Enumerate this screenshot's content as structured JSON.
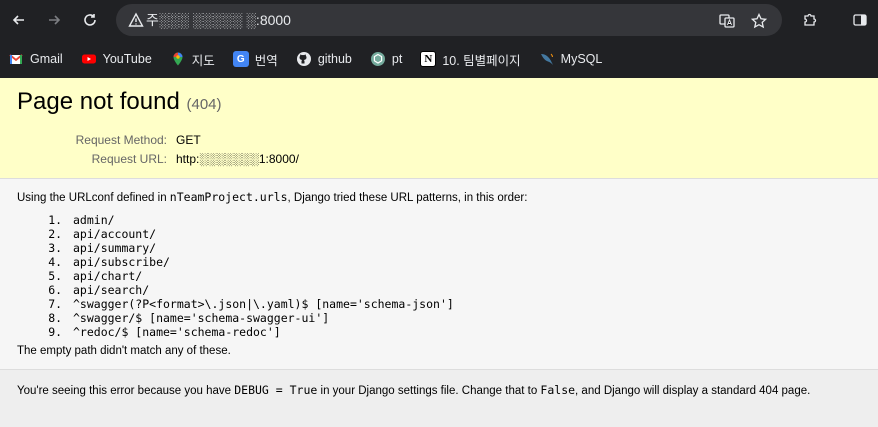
{
  "browser": {
    "url": "주░░░ ░░░░░ ░:8000",
    "bookmarks": [
      {
        "label": "Gmail",
        "icon": "gmail-icon"
      },
      {
        "label": "YouTube",
        "icon": "youtube-icon"
      },
      {
        "label": "지도",
        "icon": "maps-icon"
      },
      {
        "label": "번역",
        "icon": "translate-icon"
      },
      {
        "label": "github",
        "icon": "github-icon"
      },
      {
        "label": "pt",
        "icon": "chatgpt-icon"
      },
      {
        "label": "10. 팀별페이지",
        "icon": "notion-icon"
      },
      {
        "label": "MySQL",
        "icon": "mysql-icon"
      }
    ]
  },
  "summary": {
    "title": "Page not found",
    "code": "(404)",
    "request_method_label": "Request Method:",
    "request_method": "GET",
    "request_url_label": "Request URL:",
    "request_url": "http:░░░░░░░1:8000/"
  },
  "info": {
    "intro_prefix": "Using the URLconf defined in ",
    "urlconf": "nTeamProject.urls",
    "intro_suffix": ", Django tried these URL patterns, in this order:",
    "patterns": [
      "admin/",
      "api/account/",
      "api/summary/",
      "api/subscribe/",
      "api/chart/",
      "api/search/",
      "^swagger(?P<format>\\.json|\\.yaml)$ [name='schema-json']",
      "^swagger/$ [name='schema-swagger-ui']",
      "^redoc/$ [name='schema-redoc']"
    ],
    "tail": "The empty path didn't match any of these."
  },
  "explanation": {
    "part1": "You're seeing this error because you have ",
    "debug_code": "DEBUG = True",
    "part2": " in your Django settings file. Change that to ",
    "false_code": "False",
    "part3": ", and Django will display a standard 404 page."
  }
}
